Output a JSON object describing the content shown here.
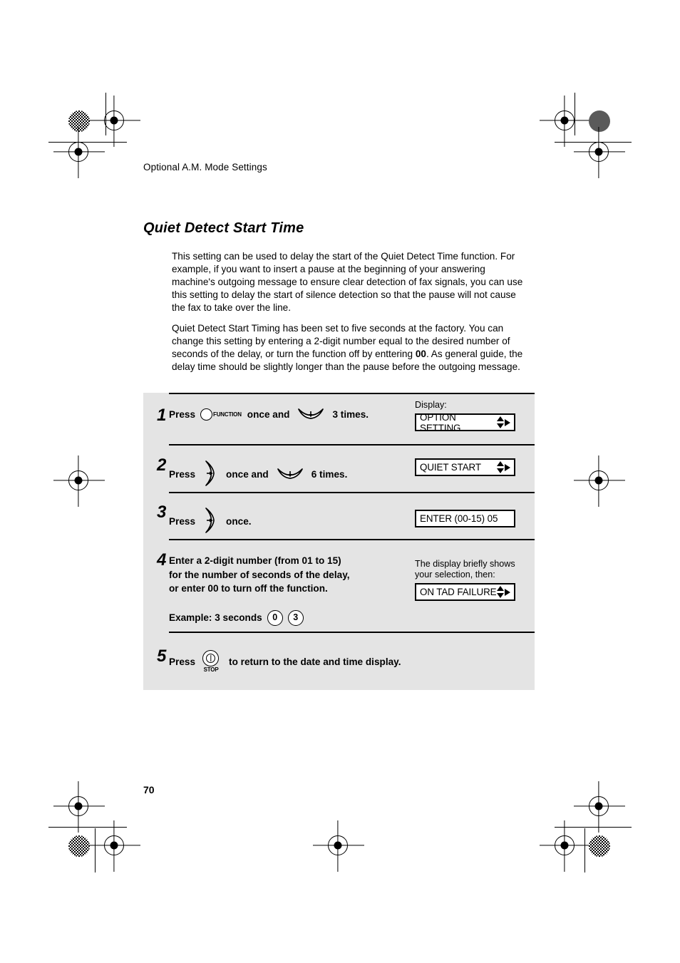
{
  "page": {
    "running_head": "Optional A.M. Mode Settings",
    "section_title": "Quiet Detect Start Time",
    "page_number": "70"
  },
  "paragraphs": {
    "p1": "This setting can be used to delay the start of the Quiet Detect Time function. For example, if you want to insert a pause at the beginning of your answering machine's outgoing message to ensure clear detection of fax signals, you can use this setting to delay the start of silence detection so that the pause will not cause the fax to take over the line.",
    "p2_part1": "Quiet Detect Start Timing has been set to five seconds at the factory. You can change this setting by entering a 2-digit number equal to the desired number of seconds of the delay, or turn the function off by enttering ",
    "p2_bold": "00",
    "p2_part2": ". As general guide, the delay time should be slightly longer than the pause before the outgoing message."
  },
  "steps": [
    {
      "number": "1",
      "press_label": "Press",
      "key1_label": "FUNCTION",
      "mid_text": "once and",
      "key2": "down-arrow-rocker-key",
      "tail_text": "3 times.",
      "display_caption": "Display:",
      "display_text": "OPTION SETTING",
      "display_arrows": "up-down-right"
    },
    {
      "number": "2",
      "press_label": "Press",
      "key1": "right-arrow-rocker-key",
      "mid_text": "once and",
      "key2": "down-arrow-rocker-key",
      "tail_text": "6 times.",
      "display_text": "QUIET START",
      "display_arrows": "up-down-right"
    },
    {
      "number": "3",
      "press_label": "Press",
      "key1": "right-arrow-rocker-key",
      "tail_text": "once.",
      "display_text": "ENTER (00-15) 05",
      "display_arrows": "none"
    },
    {
      "number": "4",
      "instruction_line1": "Enter a 2-digit number (from 01 to 15)",
      "instruction_line2": "for the number of seconds of the delay,",
      "instruction_line3": "or enter 00 to turn off the function.",
      "example_label": "Example: 3 seconds",
      "example_keys": [
        "0",
        "3"
      ],
      "display_caption_line1": "The display briefly shows",
      "display_caption_line2": "your selection, then:",
      "display_text": "ON TAD FAILURE",
      "display_arrows": "up-down-right"
    },
    {
      "number": "5",
      "press_label": "Press",
      "key1": "stop-key",
      "key1_label": "STOP",
      "tail_text": "to return to the date and time display."
    }
  ],
  "colors": {
    "panel_background": "#e4e4e4",
    "page_background": "#ffffff",
    "text": "#000000",
    "lcd_background": "#ffffff"
  }
}
